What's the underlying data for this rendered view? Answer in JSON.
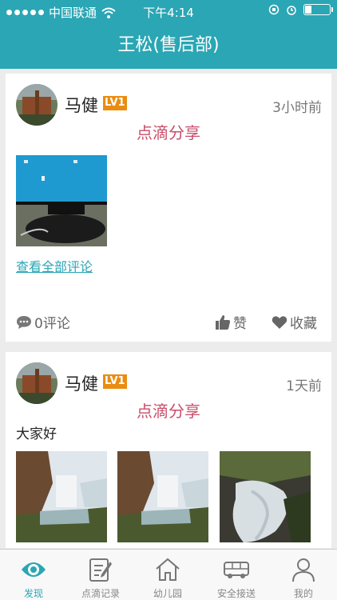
{
  "status_bar": {
    "carrier": "中国联通",
    "time": "下午4:14",
    "battery_level": 0.25,
    "icons": [
      "signal-dots",
      "wifi-icon",
      "rotation-lock-icon",
      "alarm-icon",
      "battery-icon"
    ]
  },
  "header": {
    "title": "王松(售后部)"
  },
  "posts": [
    {
      "author": "马健",
      "level": "LV1",
      "time": "3小时前",
      "subtitle": "点滴分享",
      "photos": [
        "monitor-photo"
      ],
      "view_all_comments": "查看全部评论",
      "comments": "0评论",
      "like": "赞",
      "favorite": "收藏"
    },
    {
      "author": "马健",
      "level": "LV1",
      "time": "1天前",
      "subtitle": "点滴分享",
      "text": "大家好",
      "photos": [
        "waterfall-photo",
        "waterfall-photo",
        "stream-photo"
      ]
    }
  ],
  "tabbar": {
    "active": 0,
    "items": [
      {
        "label": "发现",
        "icon": "eye-icon"
      },
      {
        "label": "点滴记录",
        "icon": "notepad-icon"
      },
      {
        "label": "幼儿园",
        "icon": "house-icon"
      },
      {
        "label": "安全接送",
        "icon": "bus-icon"
      },
      {
        "label": "我的",
        "icon": "person-icon"
      }
    ]
  },
  "colors": {
    "primary": "#2aa6b4",
    "share_text": "#c94d6a",
    "level_badge": "#e98d11"
  }
}
